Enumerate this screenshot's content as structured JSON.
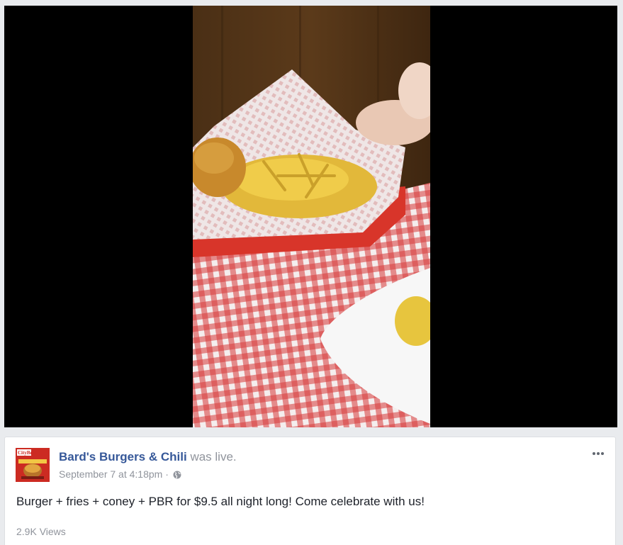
{
  "post": {
    "page_name": "Bard's Burgers & Chili",
    "action": "was live.",
    "date": "September 7 at 4:18pm",
    "separator": "·",
    "privacy_icon": "globe-icon",
    "more_icon": "more-options-icon",
    "message": "Burger + fries + coney + PBR for $9.5 all night long! Come celebrate with us!",
    "views": "2.9K Views",
    "avatar_logo_text": "CityBeat"
  },
  "colors": {
    "page_background": "#e9ebee",
    "link_blue": "#365899",
    "meta_gray": "#90949c",
    "text": "#1d2129",
    "video_bg": "#000000"
  }
}
